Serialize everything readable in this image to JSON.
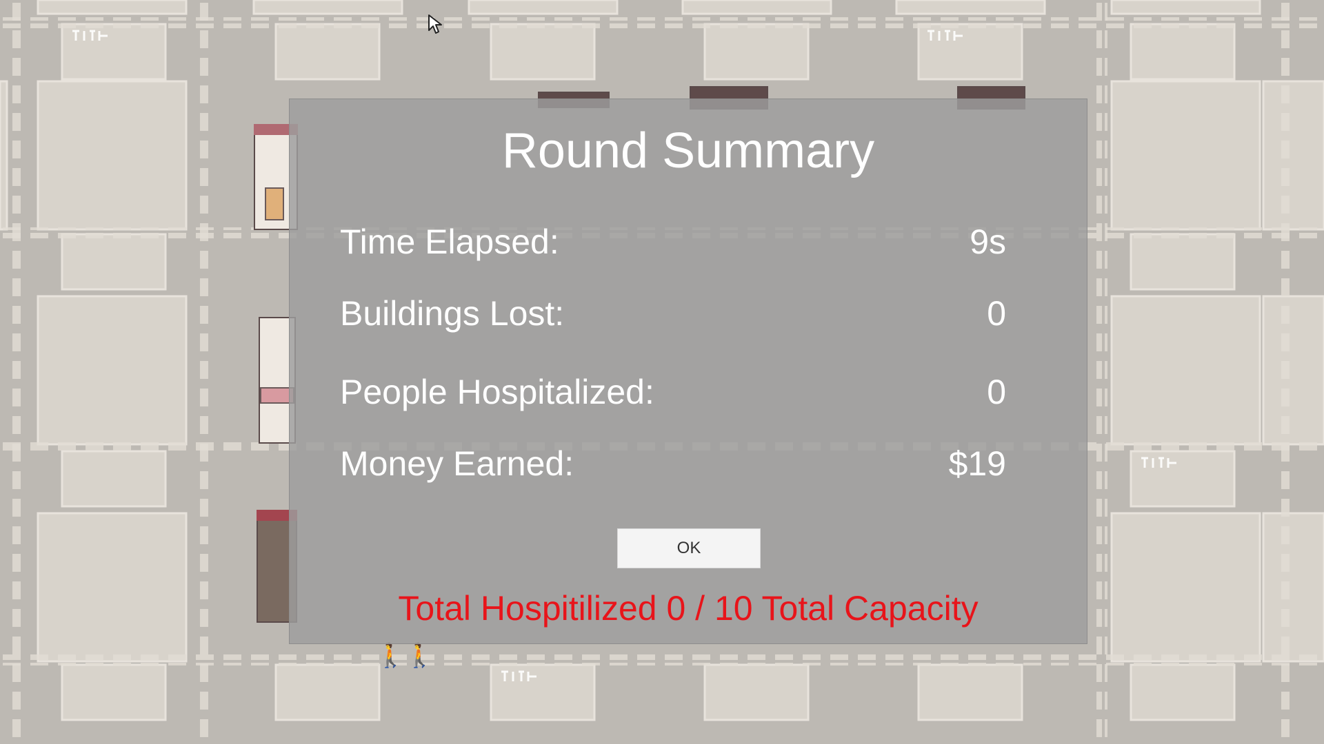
{
  "modal": {
    "title": "Round Summary",
    "stats": [
      {
        "label": "Time Elapsed:",
        "value": "9s"
      },
      {
        "label": "Buildings Lost:",
        "value": "0"
      },
      {
        "label": "People Hospitalized:",
        "value": "0"
      },
      {
        "label": "Money Earned:",
        "value": "$19"
      }
    ],
    "ok_label": "OK",
    "capacity_text": "Total Hospitilized 0 / 10 Total Capacity"
  },
  "map": {
    "people_icon": "people-icon",
    "cursor_icon": "cursor-icon"
  },
  "colors": {
    "background": "#bdb9b3",
    "block": "#d8d3cb",
    "modal_overlay": "#9e9e9e",
    "capacity_text": "#e8141a",
    "title_text": "#ffffff",
    "button": "#f4f4f4"
  }
}
